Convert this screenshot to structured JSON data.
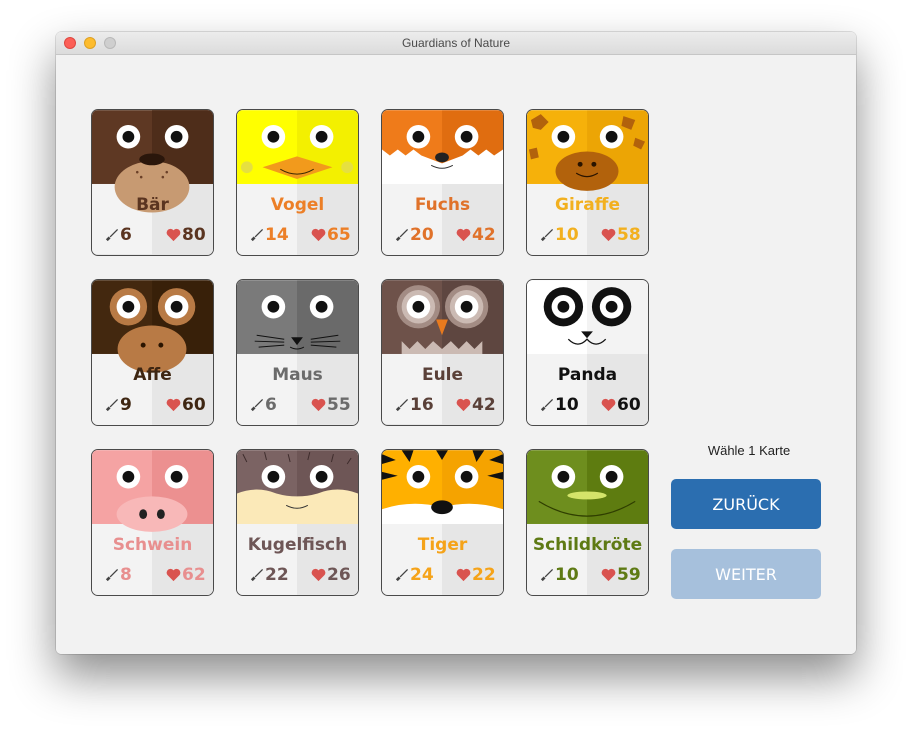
{
  "window": {
    "title": "Guardians of Nature"
  },
  "hint": "Wähle 1 Karte",
  "buttons": {
    "back": "ZURÜCK",
    "next": "WEITER"
  },
  "cards": [
    {
      "name": "Bär",
      "attack": "6",
      "health": "80",
      "color": "#5a3420",
      "selected": true
    },
    {
      "name": "Vogel",
      "attack": "14",
      "health": "65",
      "color": "#ec7f27",
      "selected": false
    },
    {
      "name": "Fuchs",
      "attack": "20",
      "health": "42",
      "color": "#e0722a",
      "selected": false
    },
    {
      "name": "Giraffe",
      "attack": "10",
      "health": "58",
      "color": "#f2b01f",
      "selected": false
    },
    {
      "name": "Affe",
      "attack": "9",
      "health": "60",
      "color": "#3e2612",
      "selected": false
    },
    {
      "name": "Maus",
      "attack": "6",
      "health": "55",
      "color": "#6b6b6b",
      "selected": false
    },
    {
      "name": "Eule",
      "attack": "16",
      "health": "42",
      "color": "#5a4038",
      "selected": true
    },
    {
      "name": "Panda",
      "attack": "10",
      "health": "60",
      "color": "#111111",
      "selected": false
    },
    {
      "name": "Schwein",
      "attack": "8",
      "health": "62",
      "color": "#e88f8f",
      "selected": false
    },
    {
      "name": "Kugelfisch",
      "attack": "22",
      "health": "26",
      "color": "#6e5656",
      "selected": false
    },
    {
      "name": "Tiger",
      "attack": "24",
      "health": "22",
      "color": "#f5a319",
      "selected": false
    },
    {
      "name": "Schildkröte",
      "attack": "10",
      "health": "59",
      "color": "#5e7a14",
      "selected": false
    }
  ]
}
